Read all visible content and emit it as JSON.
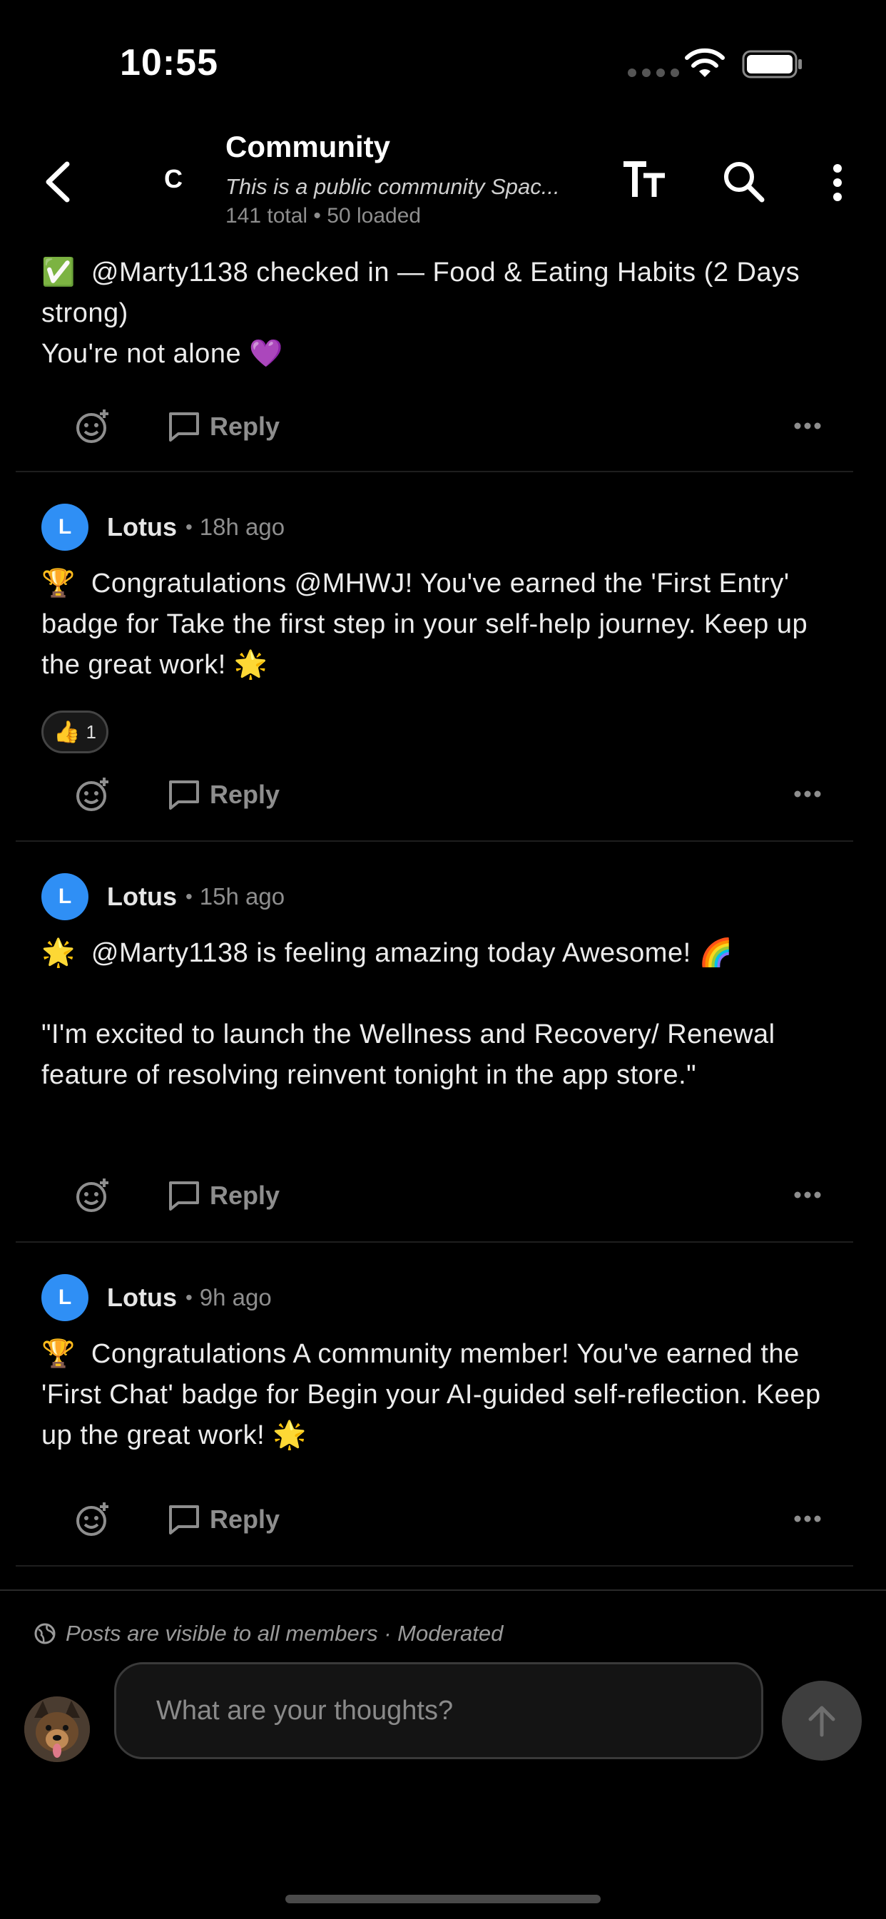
{
  "status_bar": {
    "time": "10:55"
  },
  "header": {
    "avatar_letter": "C",
    "title": "Community",
    "subtitle": "This is a public community Spac...",
    "count": "141 total • 50 loaded"
  },
  "posts": [
    {
      "text": "✅  @Marty1138 checked in — Food & Eating Habits (2 Days strong)\nYou're not alone 💜",
      "reply_label": "Reply"
    },
    {
      "author": "Lotus",
      "avatar_letter": "L",
      "separator": "•",
      "time": "18h ago",
      "text": "🏆  Congratulations @MHWJ! You've earned the 'First Entry' badge for Take the first step in your self-help journey. Keep up the great work! 🌟",
      "reaction": {
        "emoji": "👍",
        "count": "1"
      },
      "reply_label": "Reply"
    },
    {
      "author": "Lotus",
      "avatar_letter": "L",
      "separator": "•",
      "time": "15h ago",
      "text": "🌟  @Marty1138 is feeling amazing today Awesome! 🌈\n\n\"I'm excited to launch the Wellness and Recovery/ Renewal feature of resolving reinvent tonight in the app store.\"",
      "reply_label": "Reply"
    },
    {
      "author": "Lotus",
      "avatar_letter": "L",
      "separator": "•",
      "time": "9h ago",
      "text": "🏆  Congratulations A community member! You've earned the 'First Chat' badge for Begin your AI-guided self-reflection. Keep up the great work! 🌟",
      "reply_label": "Reply"
    }
  ],
  "composer": {
    "visibility_note": "Posts are visible to all members · Moderated",
    "placeholder": "What are your thoughts?"
  },
  "colors": {
    "accent": "#2f8ff5",
    "background": "#000000",
    "muted": "#8e8e8e"
  }
}
